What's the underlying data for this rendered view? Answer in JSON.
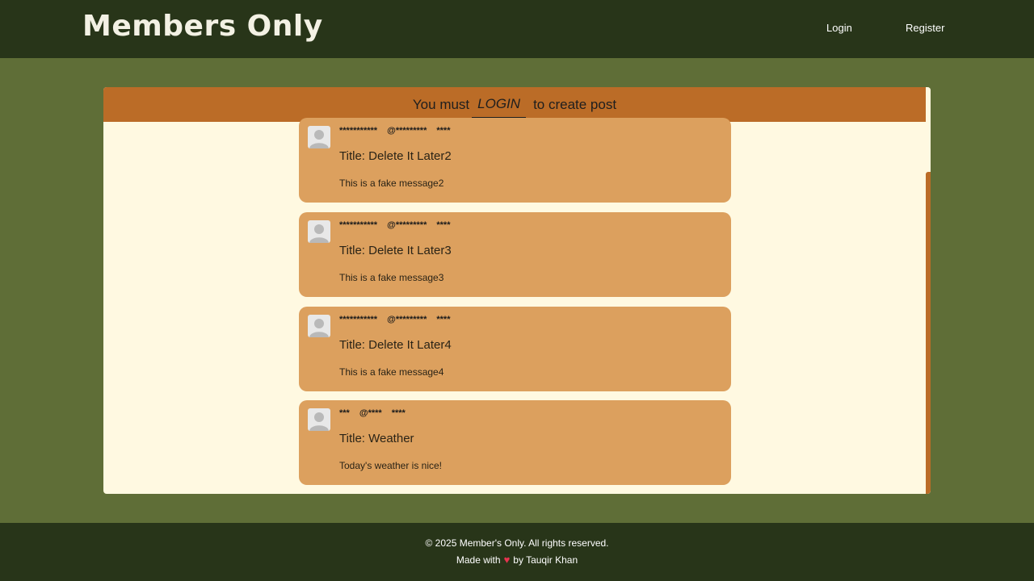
{
  "header": {
    "brand": "Members Only",
    "nav": {
      "login": "Login",
      "register": "Register"
    }
  },
  "banner": {
    "prefix": "You must",
    "link": "LOGIN",
    "suffix": "to create post"
  },
  "posts": [
    {
      "author": "***********",
      "handle": "@*********",
      "date": "****",
      "title": "Title: Delete It Later2",
      "body": "This is a fake message2"
    },
    {
      "author": "***********",
      "handle": "@*********",
      "date": "****",
      "title": "Title: Delete It Later3",
      "body": "This is a fake message3"
    },
    {
      "author": "***********",
      "handle": "@*********",
      "date": "****",
      "title": "Title: Delete It Later4",
      "body": "This is a fake message4"
    },
    {
      "author": "***",
      "handle": "@****",
      "date": "****",
      "title": "Title: Weather",
      "body": "Today's weather is nice!"
    }
  ],
  "footer": {
    "copyright": "© 2025 Member's Only. All rights reserved.",
    "made_prefix": "Made with",
    "made_icon": "heart-icon",
    "made_suffix": "by Tauqir Khan"
  },
  "colors": {
    "page_bg": "#5f6e37",
    "bar_bg": "#283519",
    "banner_bg": "#bb6c27",
    "panel_bg": "#fff9e1",
    "post_bg": "#dca05e",
    "heart": "#e8334f"
  }
}
